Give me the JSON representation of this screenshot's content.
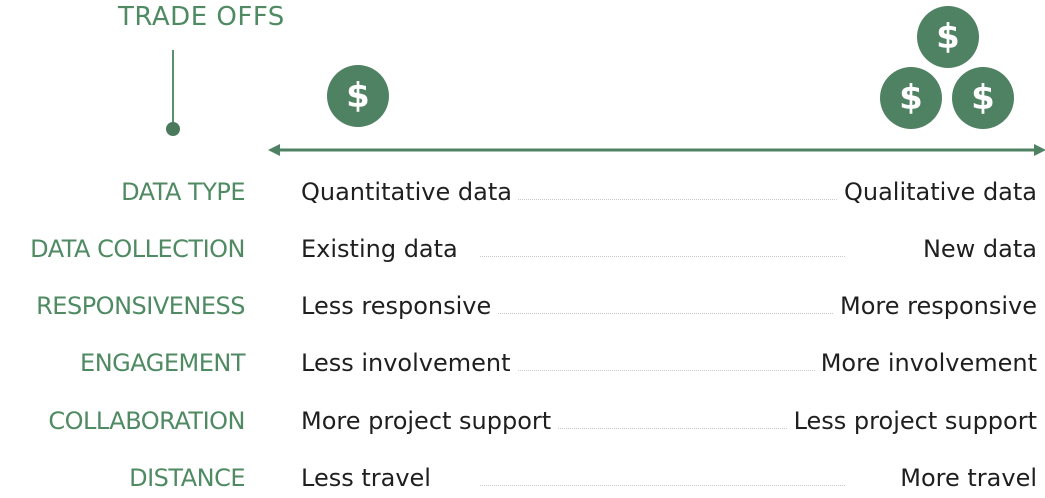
{
  "title": "TRADE OFFS",
  "colors": {
    "accent": "#4f8a63",
    "coin": "#4f8262",
    "text": "#1f1f1f"
  },
  "icons": [
    "dollar-coin-icon"
  ],
  "rows": [
    {
      "label": "DATA TYPE",
      "left": "Quantitative data",
      "right": "Qualitative data"
    },
    {
      "label": "DATA COLLECTION",
      "left": "Existing data",
      "right": "New data"
    },
    {
      "label": "RESPONSIVENESS",
      "left": "Less responsive",
      "right": "More responsive"
    },
    {
      "label": "ENGAGEMENT",
      "left": "Less involvement",
      "right": "More involvement"
    },
    {
      "label": "COLLABORATION",
      "left": "More project support",
      "right": "Less project support"
    },
    {
      "label": "DISTANCE",
      "left": "Less travel",
      "right": "More travel"
    }
  ]
}
